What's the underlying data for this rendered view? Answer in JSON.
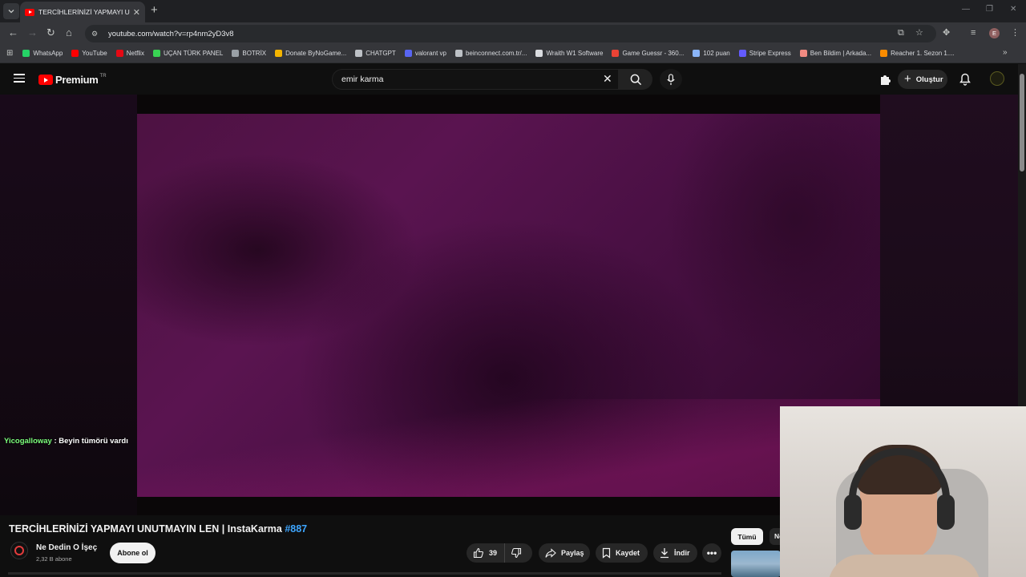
{
  "browser": {
    "tab_title": "TERCİHLERİNİZİ YAPMAYI UNUTMAYIN LEN | InstaKarma #887",
    "url": "youtube.com/watch?v=rp4nm2yD3v8",
    "profile_initial": "E",
    "bookmarks": [
      {
        "label": "WhatsApp",
        "color": "#25d366"
      },
      {
        "label": "YouTube",
        "color": "#ff0000"
      },
      {
        "label": "Netflix",
        "color": "#e50914"
      },
      {
        "label": "UÇAN TÜRK PANEL",
        "color": "#39d353"
      },
      {
        "label": "BOTRİX",
        "color": "#9aa0a6"
      },
      {
        "label": "Donate ByNoGame...",
        "color": "#f4b400"
      },
      {
        "label": "CHATGPT",
        "color": "#bdc1c6"
      },
      {
        "label": "valorant vp",
        "color": "#5865f2"
      },
      {
        "label": "beinconnect.com.tr/...",
        "color": "#bdc1c6"
      },
      {
        "label": "Wraith W1 Software",
        "color": "#dadce0"
      },
      {
        "label": "Game Guessr - 360...",
        "color": "#ea4335"
      },
      {
        "label": "102 puan",
        "color": "#8ab4f8"
      },
      {
        "label": "Stripe Express",
        "color": "#635bff"
      },
      {
        "label": "Ben Bildim | Arkada...",
        "color": "#f28b82"
      },
      {
        "label": "Reacher 1. Sezon 1....",
        "color": "#fb8c00"
      }
    ]
  },
  "youtube": {
    "logo_text": "Premium",
    "country_code": "TR",
    "search_value": "emir karma",
    "create_label": "Oluştur",
    "chat": {
      "user": "Yicogalloway",
      "message": " : Beyin tümörü vardı"
    },
    "video": {
      "title": "TERCİHLERİNİZİ YAPMAYI UNUTMAYIN LEN | InstaKarma ",
      "title_tag": "#887",
      "channel_name": "Ne Dedin O İşeç",
      "subscribers": "2,32 B abone",
      "subscribe_label": "Abone ol",
      "like_count": "39",
      "share_label": "Paylaş",
      "save_label": "Kaydet",
      "download_label": "İndir"
    },
    "chips": {
      "all_label": "Tümü",
      "next_label": "Ne"
    }
  },
  "colors": {
    "brand_red": "#ff0000",
    "link_blue": "#3ea6ff",
    "chat_user_green": "#7cff7c"
  }
}
